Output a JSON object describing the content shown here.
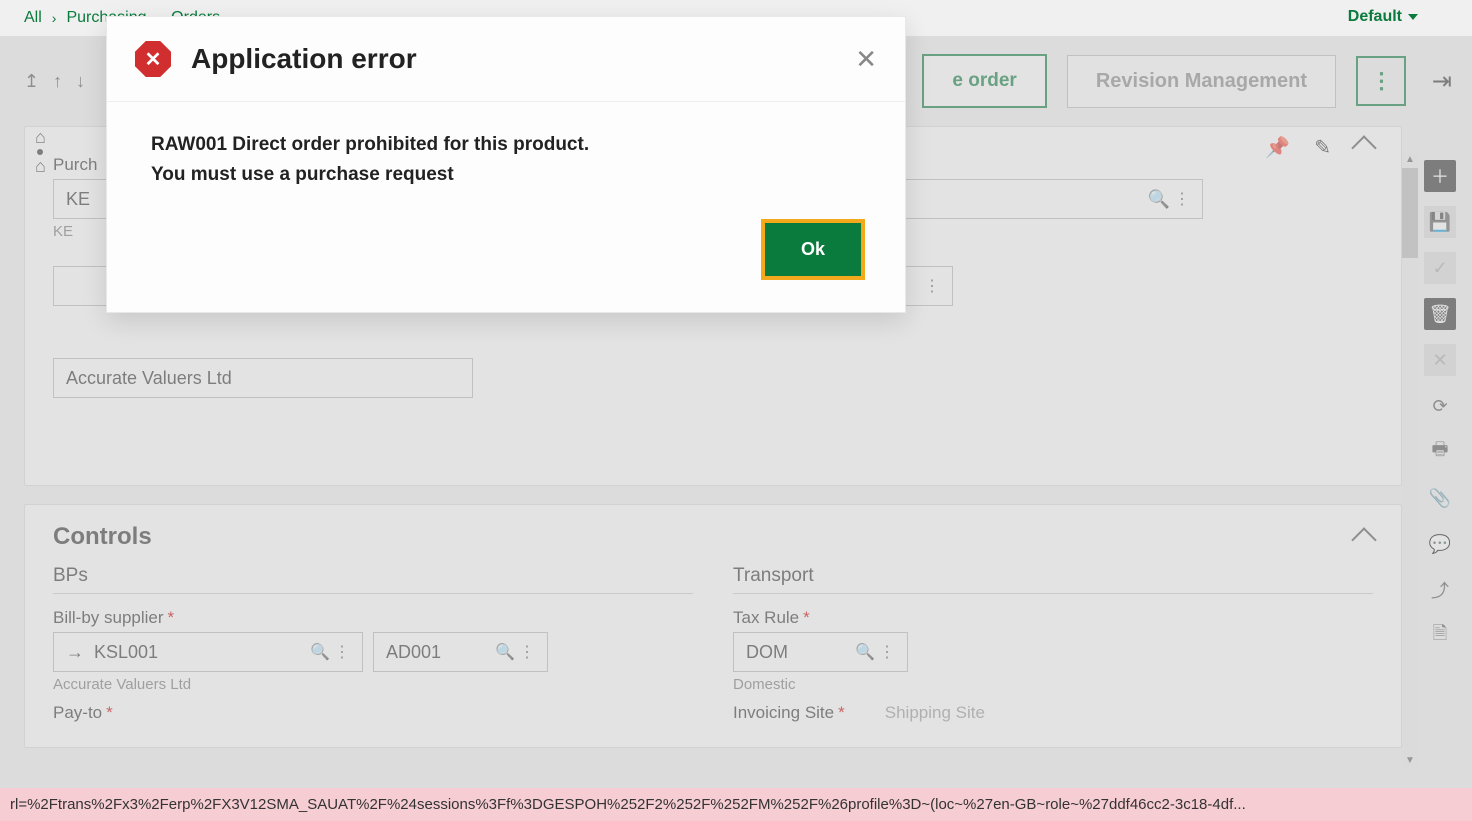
{
  "breadcrumb": {
    "root": "All",
    "l1": "Purchasing",
    "l2": "Orders"
  },
  "header": {
    "default_label": "Default"
  },
  "actions": {
    "create_order": "e order",
    "revision": "Revision Management"
  },
  "panel1": {
    "purchase_label": "Purch",
    "site_value": "KE",
    "site_helper": "KE",
    "vendor_name": "Accurate Valuers Ltd"
  },
  "controls": {
    "title": "Controls",
    "bps_title": "BPs",
    "transport_title": "Transport",
    "bill_by_label": "Bill-by supplier",
    "bill_by_value": "KSL001",
    "bill_by_addr": "AD001",
    "bill_by_helper": "Accurate Valuers Ltd",
    "pay_to_label": "Pay-to",
    "tax_rule_label": "Tax Rule",
    "tax_rule_value": "DOM",
    "tax_rule_helper": "Domestic",
    "invoicing_site_label": "Invoicing Site",
    "shipping_site_label": "Shipping Site"
  },
  "modal": {
    "title": "Application error",
    "line1": "RAW001 Direct order prohibited for this product.",
    "line2": "You must use a purchase request",
    "ok": "Ok"
  },
  "url_bar": "rl=%2Ftrans%2Fx3%2Ferp%2FX3V12SMA_SAUAT%2F%24sessions%3Ff%3DGESPOH%252F2%252F%252FM%252F%26profile%3D~(loc~%27en-GB~role~%27ddf46cc2-3c18-4df..."
}
